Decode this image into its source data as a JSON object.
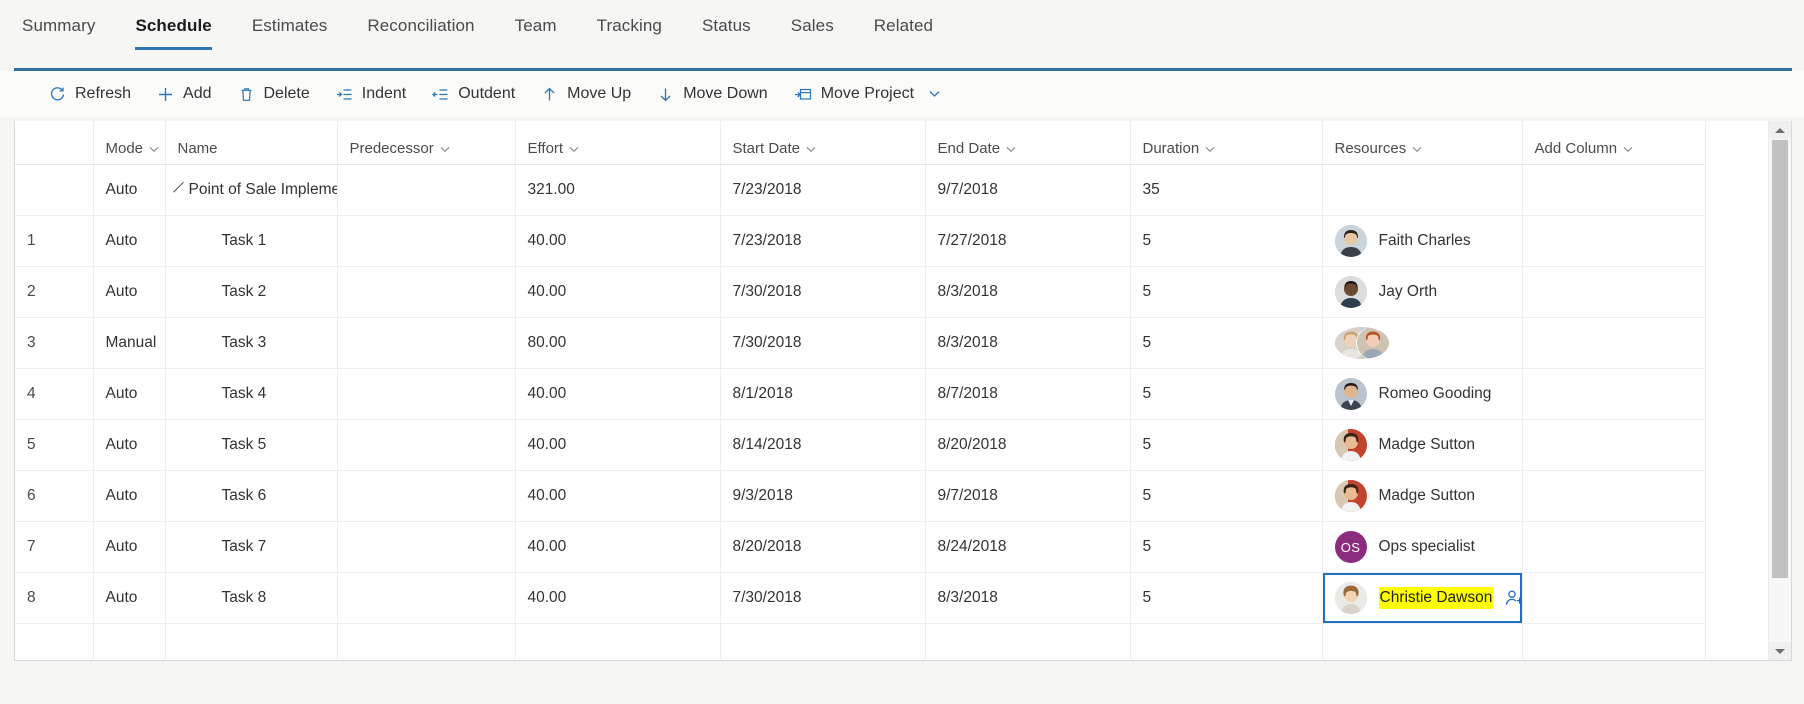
{
  "tabs": [
    {
      "label": "Summary",
      "active": false
    },
    {
      "label": "Schedule",
      "active": true
    },
    {
      "label": "Estimates",
      "active": false
    },
    {
      "label": "Reconciliation",
      "active": false
    },
    {
      "label": "Team",
      "active": false
    },
    {
      "label": "Tracking",
      "active": false
    },
    {
      "label": "Status",
      "active": false
    },
    {
      "label": "Sales",
      "active": false
    },
    {
      "label": "Related",
      "active": false
    }
  ],
  "commandbar": {
    "items": [
      {
        "label": "Refresh",
        "icon": "refresh-icon"
      },
      {
        "label": "Add",
        "icon": "plus-icon"
      },
      {
        "label": "Delete",
        "icon": "trash-icon"
      },
      {
        "label": "Indent",
        "icon": "indent-icon"
      },
      {
        "label": "Outdent",
        "icon": "outdent-icon"
      },
      {
        "label": "Move Up",
        "icon": "arrow-up-icon"
      },
      {
        "label": "Move Down",
        "icon": "arrow-down-icon"
      },
      {
        "label": "Move Project",
        "icon": "move-project-icon",
        "caret": true
      }
    ]
  },
  "grid": {
    "columns": [
      {
        "key": "idx",
        "label": "",
        "caret": false,
        "align": "left"
      },
      {
        "key": "mode",
        "label": "Mode",
        "caret": true,
        "align": "left"
      },
      {
        "key": "name",
        "label": "Name",
        "caret": false,
        "align": "left"
      },
      {
        "key": "pred",
        "label": "Predecessor",
        "caret": true,
        "align": "left"
      },
      {
        "key": "eff",
        "label": "Effort",
        "caret": true,
        "align": "left"
      },
      {
        "key": "start",
        "label": "Start Date",
        "caret": true,
        "align": "left"
      },
      {
        "key": "end",
        "label": "End Date",
        "caret": true,
        "align": "left"
      },
      {
        "key": "dur",
        "label": "Duration",
        "caret": true,
        "align": "left"
      },
      {
        "key": "res",
        "label": "Resources",
        "caret": true,
        "align": "left"
      },
      {
        "key": "add",
        "label": "Add Column",
        "caret": true,
        "align": "left"
      }
    ],
    "rows": [
      {
        "idx": "",
        "mode": "Auto",
        "name": "Point of Sale Implementat",
        "summary": true,
        "pred": "",
        "effort": "321.00",
        "start": "7/23/2018",
        "end": "9/7/2018",
        "duration": "35",
        "resources": []
      },
      {
        "idx": "1",
        "mode": "Auto",
        "name": "Task 1",
        "summary": false,
        "pred": "",
        "effort": "40.00",
        "start": "7/23/2018",
        "end": "7/27/2018",
        "duration": "5",
        "resources": [
          {
            "name": "Faith Charles",
            "type": "photo",
            "tone": "#e6c7a8",
            "hair": "#2a2018"
          }
        ]
      },
      {
        "idx": "2",
        "mode": "Auto",
        "name": "Task 2",
        "summary": false,
        "pred": "",
        "effort": "40.00",
        "start": "7/30/2018",
        "end": "8/3/2018",
        "duration": "5",
        "resources": [
          {
            "name": "Jay Orth",
            "type": "photo",
            "tone": "#6b4a33",
            "hair": "#1b1310"
          }
        ]
      },
      {
        "idx": "3",
        "mode": "Manual",
        "name": "Task 3",
        "summary": false,
        "pred": "",
        "effort": "80.00",
        "start": "7/30/2018",
        "end": "8/3/2018",
        "duration": "5",
        "resources": [
          {
            "name": "",
            "type": "photo",
            "tone": "#f0d2bb",
            "hair": "#c8a271"
          },
          {
            "name": "",
            "type": "photo",
            "tone": "#f2cdb4",
            "hair": "#b4552c"
          }
        ]
      },
      {
        "idx": "4",
        "mode": "Auto",
        "name": "Task 4",
        "summary": false,
        "pred": "",
        "effort": "40.00",
        "start": "8/1/2018",
        "end": "8/7/2018",
        "duration": "5",
        "resources": [
          {
            "name": "Romeo Gooding",
            "type": "photo",
            "tone": "#dfb48e",
            "hair": "#22180f"
          }
        ]
      },
      {
        "idx": "5",
        "mode": "Auto",
        "name": "Task 5",
        "summary": false,
        "pred": "",
        "effort": "40.00",
        "start": "8/14/2018",
        "end": "8/20/2018",
        "duration": "5",
        "resources": [
          {
            "name": "Madge Sutton",
            "type": "photo",
            "tone": "#e8bb93",
            "hair": "#3c2415"
          }
        ]
      },
      {
        "idx": "6",
        "mode": "Auto",
        "name": "Task 6",
        "summary": false,
        "pred": "",
        "effort": "40.00",
        "start": "9/3/2018",
        "end": "9/7/2018",
        "duration": "5",
        "resources": [
          {
            "name": "Madge Sutton",
            "type": "photo",
            "tone": "#e8bb93",
            "hair": "#3c2415"
          }
        ]
      },
      {
        "idx": "7",
        "mode": "Auto",
        "name": "Task 7",
        "summary": false,
        "pred": "",
        "effort": "40.00",
        "start": "8/20/2018",
        "end": "8/24/2018",
        "duration": "5",
        "resources": [
          {
            "name": "Ops specialist",
            "type": "initials",
            "initials": "OS",
            "color": "#8c2c7f"
          }
        ]
      },
      {
        "idx": "8",
        "mode": "Auto",
        "name": "Task 8",
        "summary": false,
        "pred": "",
        "effort": "40.00",
        "start": "7/30/2018",
        "end": "8/3/2018",
        "duration": "5",
        "selected": true,
        "resources": [
          {
            "name": "Christie Dawson",
            "type": "photo",
            "tone": "#f2d3b6",
            "hair": "#9a6a3c",
            "highlight": true
          }
        ]
      }
    ]
  },
  "colors": {
    "accent": "#2b76bb",
    "rule": "#31709e",
    "selection_border": "#1f6fc4",
    "highlight": "#ffff00",
    "initials_badge": "#8c2c7f"
  },
  "scrollbar": {
    "up_arrow": "triangle-up-icon",
    "down_arrow": "triangle-down-icon"
  }
}
